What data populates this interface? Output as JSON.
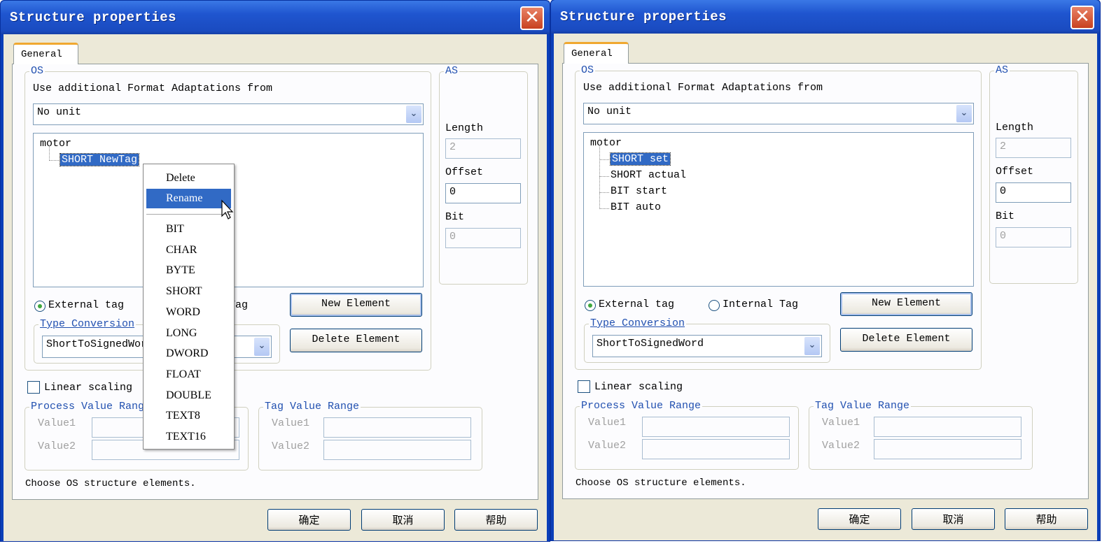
{
  "dialogs": [
    {
      "title": "Structure properties",
      "tab": "General",
      "os_label": "OS",
      "as_label": "AS",
      "format_label": "Use additional Format Adaptations from",
      "format_value": "No unit",
      "tree_root": "motor",
      "tree_items": [
        "SHORT NewTag"
      ],
      "external_tag": "External tag",
      "internal_tag": "Internal Tag",
      "tag_selected": "external",
      "type_conversion_label": "Type Conversion",
      "type_conversion_value": "ShortToSignedWord",
      "new_element": "New Element",
      "delete_element": "Delete Element",
      "length_label": "Length",
      "length_value": "2",
      "offset_label": "Offset",
      "offset_value": "0",
      "bit_label": "Bit",
      "bit_value": "0",
      "linear_scaling": "Linear scaling",
      "linear_scaling_checked": false,
      "process_range": "Process Value Range",
      "tag_range": "Tag Value Range",
      "value1": "Value1",
      "value2": "Value2",
      "status": "Choose OS structure elements.",
      "ok": "确定",
      "cancel": "取消",
      "help": "帮助",
      "context_menu": {
        "items": [
          "Delete",
          "Rename"
        ],
        "highlighted": "Rename",
        "types": [
          "BIT",
          "CHAR",
          "BYTE",
          "SHORT",
          "WORD",
          "LONG",
          "DWORD",
          "FLOAT",
          "DOUBLE",
          "TEXT8",
          "TEXT16"
        ]
      }
    },
    {
      "title": "Structure properties",
      "tab": "General",
      "os_label": "OS",
      "as_label": "AS",
      "format_label": "Use additional Format Adaptations from",
      "format_value": "No unit",
      "tree_root": "motor",
      "tree_items": [
        "SHORT set",
        "SHORT actual",
        "BIT start",
        "BIT auto"
      ],
      "external_tag": "External tag",
      "internal_tag": "Internal Tag",
      "tag_selected": "external",
      "type_conversion_label": "Type Conversion",
      "type_conversion_value": "ShortToSignedWord",
      "new_element": "New Element",
      "delete_element": "Delete Element",
      "length_label": "Length",
      "length_value": "2",
      "offset_label": "Offset",
      "offset_value": "0",
      "bit_label": "Bit",
      "bit_value": "0",
      "linear_scaling": "Linear scaling",
      "linear_scaling_checked": false,
      "process_range": "Process Value Range",
      "tag_range": "Tag Value Range",
      "value1": "Value1",
      "value2": "Value2",
      "status": "Choose OS structure elements.",
      "ok": "确定",
      "cancel": "取消",
      "help": "帮助"
    }
  ]
}
